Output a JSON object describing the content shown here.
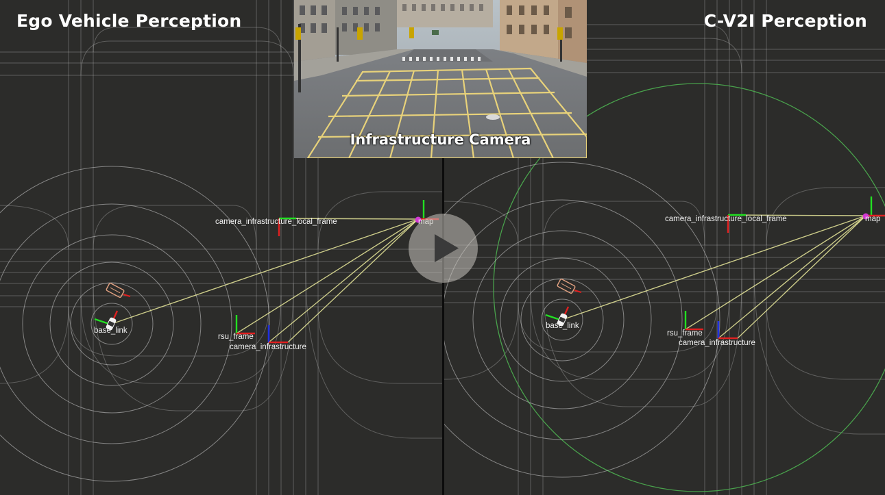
{
  "titles": {
    "left": "Ego Vehicle Perception",
    "right": "C-V2I Perception"
  },
  "camera": {
    "caption": "Infrastructure Camera"
  },
  "frames": {
    "camera_local": "camera_infrastructure_local_frame",
    "map": "map",
    "base_link": "base_link",
    "rsu": "rsu_frame",
    "camera": "camera_infrastructure"
  },
  "controls": {
    "play": "play-icon"
  },
  "colors": {
    "background": "#2c2c2a",
    "grid_lines": "#bdbdbd",
    "tf_links": "#e8e89a",
    "axis_x": "#e02020",
    "axis_y": "#22e022",
    "axis_z": "#2030e0",
    "sensor_range": "#4caf50",
    "map_marker": "#d23ad2"
  }
}
